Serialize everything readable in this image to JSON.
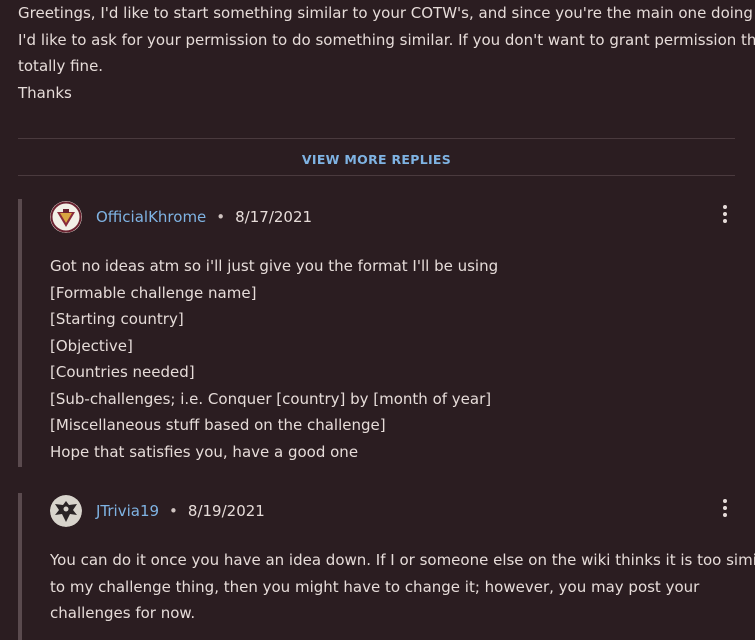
{
  "top_comment": {
    "lines": [
      "Greetings, I'd like to start something similar to your COTW's, and since you're the main one doing it,",
      "I'd like to ask for your permission to do something similar. If you don't want to grant permission that's",
      "totally fine.",
      "Thanks"
    ]
  },
  "view_more_label": "VIEW MORE REPLIES",
  "replies": [
    {
      "username": "OfficialKhrome",
      "date": "8/17/2021",
      "separator": "•",
      "lines": [
        "Got no ideas atm so i'll just give you the format I'll be using",
        "[Formable challenge name]",
        "[Starting country]",
        "[Objective]",
        "[Countries needed]",
        "[Sub-challenges; i.e. Conquer [country] by [month of year]",
        "[Miscellaneous stuff based on the challenge]",
        "Hope that satisfies you, have a good one"
      ]
    },
    {
      "username": "JTrivia19",
      "date": "8/19/2021",
      "separator": "•",
      "lines": [
        "You can do it once you have an idea down. If I or someone else on the wiki thinks it is too similar",
        "to my challenge thing, then you might have to change it; however, you may post your",
        "challenges for now."
      ]
    }
  ],
  "colors": {
    "background": "#2b1d21",
    "link": "#7fb3e3",
    "text": "#e6dcd9"
  },
  "icons": {
    "more": "vertical-ellipsis-icon",
    "avatar1": "crest-avatar",
    "avatar2": "eagle-avatar"
  }
}
